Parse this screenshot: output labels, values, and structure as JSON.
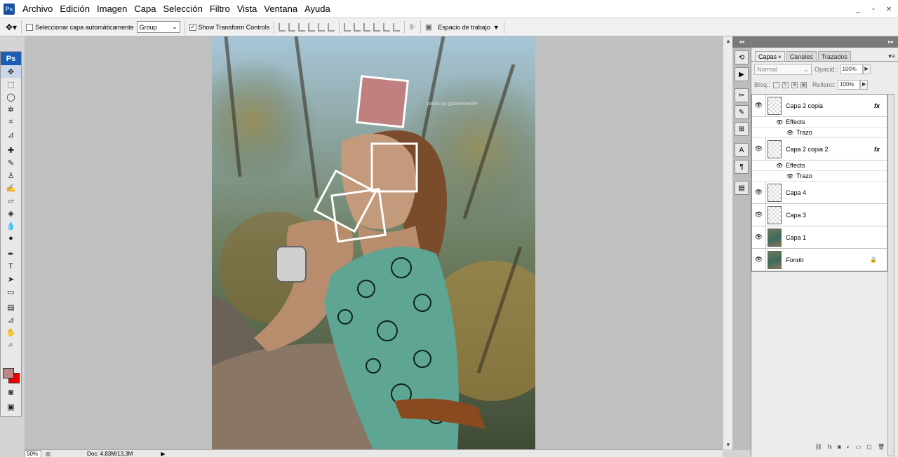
{
  "menu": {
    "app_icon": "Ps",
    "items": [
      "Archivo",
      "Edición",
      "Imagen",
      "Capa",
      "Selección",
      "Filtro",
      "Vista",
      "Ventana",
      "Ayuda"
    ]
  },
  "window_controls": {
    "minimize": "_",
    "restore": "▫",
    "close": "✕"
  },
  "options": {
    "auto_select_label": "Seleccionar capa automáticamente",
    "auto_select_value": "Group",
    "transform_label": "Show Transform Controls",
    "workspace_label": "Espacio de trabajo"
  },
  "tools": {
    "badge": "Ps",
    "items": [
      {
        "icon": "move-tool-icon",
        "glyph": "✥"
      },
      {
        "icon": "marquee-tool-icon",
        "glyph": "⬚"
      },
      {
        "icon": "lasso-tool-icon",
        "glyph": "◯"
      },
      {
        "icon": "magic-wand-icon",
        "glyph": "✲"
      },
      {
        "icon": "crop-tool-icon",
        "glyph": "⌗"
      },
      {
        "icon": "eyedropper-icon",
        "glyph": "⊿"
      },
      {
        "icon": "healing-brush-icon",
        "glyph": "✚"
      },
      {
        "icon": "brush-tool-icon",
        "glyph": "✎"
      },
      {
        "icon": "clone-stamp-icon",
        "glyph": "♙"
      },
      {
        "icon": "history-brush-icon",
        "glyph": "✍"
      },
      {
        "icon": "eraser-tool-icon",
        "glyph": "▱"
      },
      {
        "icon": "paint-bucket-icon",
        "glyph": "◈"
      },
      {
        "icon": "blur-tool-icon",
        "glyph": "💧"
      },
      {
        "icon": "dodge-tool-icon",
        "glyph": "●"
      },
      {
        "icon": "pen-tool-icon",
        "glyph": "✒"
      },
      {
        "icon": "type-tool-icon",
        "glyph": "T"
      },
      {
        "icon": "path-selection-icon",
        "glyph": "➤"
      },
      {
        "icon": "shape-tool-icon",
        "glyph": "▭"
      },
      {
        "icon": "notes-tool-icon",
        "glyph": "▤"
      },
      {
        "icon": "color-sampler-icon",
        "glyph": "⊿"
      },
      {
        "icon": "hand-tool-icon",
        "glyph": "✋"
      },
      {
        "icon": "zoom-tool-icon",
        "glyph": "⌕"
      }
    ],
    "quickmask_glyph": "◙",
    "screenmode_glyph": "▣"
  },
  "canvas": {
    "watermark": "photo by @dairelveche",
    "scroll_up": "▲",
    "scroll_down": "▼"
  },
  "status": {
    "zoom": "50%",
    "doc_size": "Doc: 4,83M/13,3M",
    "arrow": "▶"
  },
  "dock": {
    "collapse": "◂◂",
    "icons": [
      {
        "name": "history-icon",
        "glyph": "⟲"
      },
      {
        "name": "actions-icon",
        "glyph": "▶"
      },
      {
        "name": "tools-presets-icon",
        "glyph": "✂"
      },
      {
        "name": "brushes-icon",
        "glyph": "✎"
      },
      {
        "name": "clone-source-icon",
        "glyph": "⊞"
      },
      {
        "name": "character-icon",
        "glyph": "A"
      },
      {
        "name": "paragraph-icon",
        "glyph": "¶"
      },
      {
        "name": "layer-comps-icon",
        "glyph": "▤"
      }
    ]
  },
  "panel": {
    "collapse": "▸▸",
    "tabs": [
      {
        "label": "Capas",
        "close": "×",
        "active": true
      },
      {
        "label": "Canales",
        "active": false
      },
      {
        "label": "Trazados",
        "active": false
      }
    ],
    "menu_glyph": "▾≡",
    "blend_mode": "Normal",
    "opacity_label": "Opacid.:",
    "opacity_value": "100%",
    "lock_label": "Bloq.:",
    "fill_label": "Relleno:",
    "fill_value": "100%",
    "layers": [
      {
        "name": "Capa 2 copia",
        "fx": "fx",
        "effects": "Effects",
        "effect_item": "Trazo",
        "thumb": "transparent",
        "italic": false
      },
      {
        "name": "Capa 2 copia 2",
        "fx": "fx",
        "effects": "Effects",
        "effect_item": "Trazo",
        "thumb": "transparent",
        "italic": false
      },
      {
        "name": "Capa 4",
        "thumb": "transparent",
        "italic": false
      },
      {
        "name": "Capa 3",
        "thumb": "transparent",
        "italic": false
      },
      {
        "name": "Capa 1",
        "thumb": "photo",
        "italic": false
      },
      {
        "name": "Fondo",
        "thumb": "photo",
        "italic": true,
        "locked": true
      }
    ],
    "bottom_icons": [
      "⛓",
      "fx",
      "◙",
      "◐",
      "▭",
      "▢",
      "🗑"
    ]
  }
}
